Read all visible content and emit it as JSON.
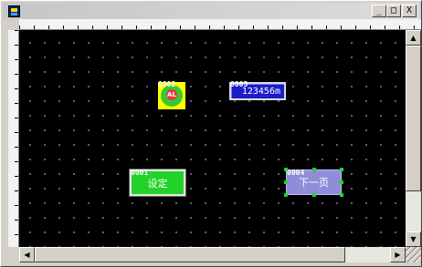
{
  "window": {
    "title": "",
    "controls": [
      "_",
      "□",
      "X"
    ]
  },
  "canvas": {
    "objects": {
      "alarm_lamp": {
        "id": "0002",
        "text": "AL"
      },
      "numeric_display": {
        "id": "0003",
        "value": "123456m"
      },
      "set_button": {
        "id": "0001",
        "label": "设定"
      },
      "next_page_button": {
        "id": "0004",
        "label": "下一页"
      }
    }
  },
  "scrollbars": {
    "up_arrow": "▲",
    "down_arrow": "▼",
    "left_arrow": "◀",
    "right_arrow": "▶"
  },
  "colors": {
    "canvas_bg": "#000000",
    "lamp_bg": "#ffff00",
    "lamp_ring": "#37c837",
    "numeric_bg": "#1c1cc8",
    "set_button_bg": "#22d22a",
    "next_button_bg": "#8e8ed8"
  }
}
